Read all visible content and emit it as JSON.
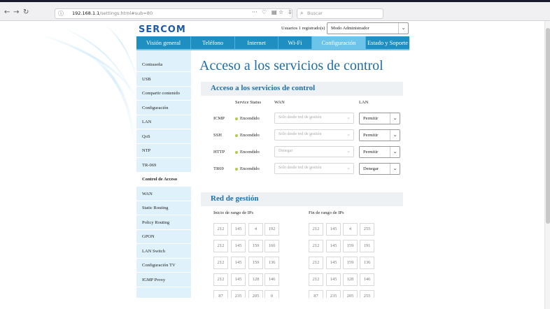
{
  "browser": {
    "back_icon": "back-arrow-icon",
    "forward_icon": "forward-arrow-icon",
    "reload_icon": "reload-icon",
    "url_host": "192.168.1.1",
    "url_path": "/settings.html#sub=80",
    "search_placeholder": "Buscar",
    "menu_icon": "more-icon"
  },
  "header": {
    "logo": "SERCOM",
    "users_label": "Usuarios 1 registrado(s)",
    "mode_select": "Modo Administrador"
  },
  "tabs": [
    {
      "label": "Visión general"
    },
    {
      "label": "Teléfono"
    },
    {
      "label": "Internet"
    },
    {
      "label": "Wi-Fi"
    },
    {
      "label": "Configuración",
      "active": true
    },
    {
      "label": "Estado y Soporte"
    }
  ],
  "sidebar": {
    "items": [
      {
        "label": "Contraseña"
      },
      {
        "label": "USB"
      },
      {
        "label": "Compartir contenido"
      },
      {
        "label": "Configuración"
      },
      {
        "label": "LAN"
      },
      {
        "label": "QoS"
      },
      {
        "label": "NTP"
      },
      {
        "label": "TR-069"
      },
      {
        "label": "Control de Acceso",
        "active": true
      },
      {
        "label": "WAN"
      },
      {
        "label": "Static Routing"
      },
      {
        "label": "Policy Routing"
      },
      {
        "label": "GPON"
      },
      {
        "label": "LAN Switch"
      },
      {
        "label": "Configuración TV"
      },
      {
        "label": "IGMP Proxy"
      }
    ]
  },
  "main": {
    "title": "Acceso a los servicios de control",
    "access_section": {
      "title": "Acceso a los servicios de control",
      "col_service_status": "Service Status",
      "col_wan": "WAN",
      "col_lan": "LAN",
      "rows": [
        {
          "service": "ICMP",
          "status": "Encendido",
          "wan": "Sólo desde red de gestión",
          "lan": "Permitir"
        },
        {
          "service": "SSH",
          "status": "Encendido",
          "wan": "Sólo desde red de gestión",
          "lan": "Permitir"
        },
        {
          "service": "HTTP",
          "status": "Encendido",
          "wan": "Denegar",
          "lan": "Permitir"
        },
        {
          "service": "TR69",
          "status": "Encendido",
          "wan": "Sólo desde red de gestión",
          "lan": "Denegar"
        }
      ]
    },
    "mgmt_section": {
      "title": "Red de gestión",
      "start_label": "Inicio de rango de IPs",
      "end_label": "Fin de rango de IPs",
      "ranges": [
        {
          "start": [
            "212",
            "145",
            "4",
            "192"
          ],
          "end": [
            "212",
            "145",
            "4",
            "255"
          ]
        },
        {
          "start": [
            "212",
            "145",
            "159",
            "160"
          ],
          "end": [
            "212",
            "145",
            "159",
            "191"
          ]
        },
        {
          "start": [
            "212",
            "145",
            "159",
            "136"
          ],
          "end": [
            "212",
            "145",
            "159",
            "136"
          ]
        },
        {
          "start": [
            "212",
            "145",
            "128",
            "146"
          ],
          "end": [
            "212",
            "145",
            "128",
            "146"
          ]
        },
        {
          "start": [
            "87",
            "235",
            "205",
            "0"
          ],
          "end": [
            "87",
            "235",
            "205",
            "255"
          ]
        }
      ]
    }
  },
  "colors": {
    "tab_bg": "#1f8ec0",
    "tab_active": "#6cc4ea",
    "sidebar_bg": "#dff1fa",
    "title_blue": "#1e6ea8",
    "status_dot": "#b9c84a"
  }
}
